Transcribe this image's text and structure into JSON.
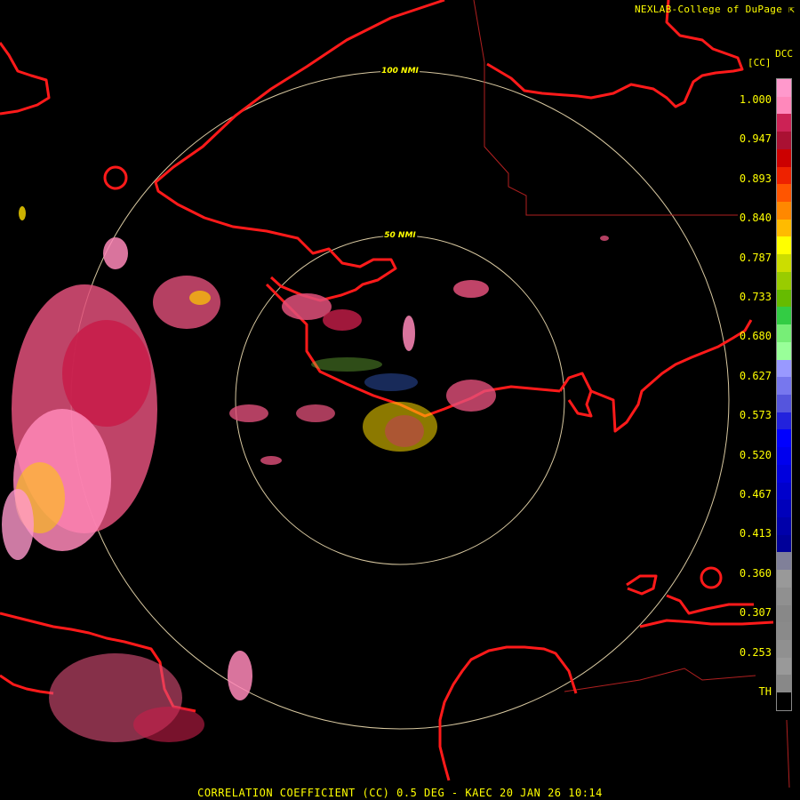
{
  "header": {
    "credit": "NEXLAB-College of DuPage",
    "product_code": "DCC",
    "unit_label": "[CC]"
  },
  "range_rings": [
    {
      "label": "100 NMI",
      "range_nmi": 100
    },
    {
      "label": "50 NMI",
      "range_nmi": 50
    }
  ],
  "legend": {
    "tick_labels": [
      "1.000",
      "0.947",
      "0.893",
      "0.840",
      "0.787",
      "0.733",
      "0.680",
      "0.627",
      "0.573",
      "0.520",
      "0.467",
      "0.413",
      "0.360",
      "0.307",
      "0.253",
      "TH"
    ],
    "colors": [
      "#ff99cc",
      "#ff88bb",
      "#cc2255",
      "#aa1133",
      "#cc0000",
      "#ee2200",
      "#ff5500",
      "#ff8800",
      "#ffbb00",
      "#ffff00",
      "#ccdd00",
      "#99cc00",
      "#66bb00",
      "#33cc44",
      "#77ee77",
      "#99ff99",
      "#9999ff",
      "#7777ee",
      "#5555dd",
      "#2222dd",
      "#0000ff",
      "#0000ee",
      "#0000dd",
      "#0000cc",
      "#0000bb",
      "#0000aa",
      "#000099",
      "#808099",
      "#999999",
      "#909090",
      "#888888",
      "#8a8a8a",
      "#909090",
      "#999999",
      "#888888",
      "#000000"
    ]
  },
  "footer": {
    "caption": "CORRELATION COEFFICIENT (CC) 0.5 DEG - KAEC 20 JAN 26 10:14"
  }
}
